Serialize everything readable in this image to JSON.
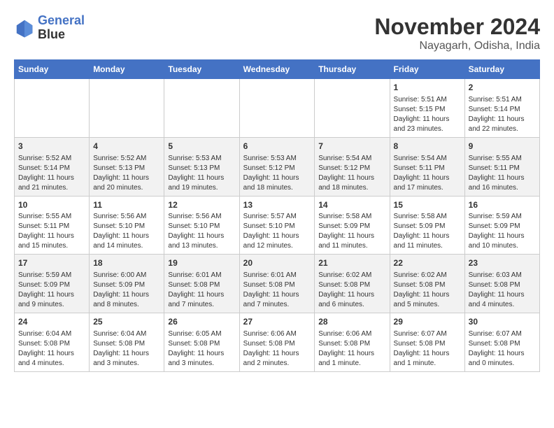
{
  "header": {
    "logo_line1": "General",
    "logo_line2": "Blue",
    "title": "November 2024",
    "subtitle": "Nayagarh, Odisha, India"
  },
  "days_of_week": [
    "Sunday",
    "Monday",
    "Tuesday",
    "Wednesday",
    "Thursday",
    "Friday",
    "Saturday"
  ],
  "weeks": [
    [
      {
        "day": "",
        "info": ""
      },
      {
        "day": "",
        "info": ""
      },
      {
        "day": "",
        "info": ""
      },
      {
        "day": "",
        "info": ""
      },
      {
        "day": "",
        "info": ""
      },
      {
        "day": "1",
        "info": "Sunrise: 5:51 AM\nSunset: 5:15 PM\nDaylight: 11 hours and 23 minutes."
      },
      {
        "day": "2",
        "info": "Sunrise: 5:51 AM\nSunset: 5:14 PM\nDaylight: 11 hours and 22 minutes."
      }
    ],
    [
      {
        "day": "3",
        "info": "Sunrise: 5:52 AM\nSunset: 5:14 PM\nDaylight: 11 hours and 21 minutes."
      },
      {
        "day": "4",
        "info": "Sunrise: 5:52 AM\nSunset: 5:13 PM\nDaylight: 11 hours and 20 minutes."
      },
      {
        "day": "5",
        "info": "Sunrise: 5:53 AM\nSunset: 5:13 PM\nDaylight: 11 hours and 19 minutes."
      },
      {
        "day": "6",
        "info": "Sunrise: 5:53 AM\nSunset: 5:12 PM\nDaylight: 11 hours and 18 minutes."
      },
      {
        "day": "7",
        "info": "Sunrise: 5:54 AM\nSunset: 5:12 PM\nDaylight: 11 hours and 18 minutes."
      },
      {
        "day": "8",
        "info": "Sunrise: 5:54 AM\nSunset: 5:11 PM\nDaylight: 11 hours and 17 minutes."
      },
      {
        "day": "9",
        "info": "Sunrise: 5:55 AM\nSunset: 5:11 PM\nDaylight: 11 hours and 16 minutes."
      }
    ],
    [
      {
        "day": "10",
        "info": "Sunrise: 5:55 AM\nSunset: 5:11 PM\nDaylight: 11 hours and 15 minutes."
      },
      {
        "day": "11",
        "info": "Sunrise: 5:56 AM\nSunset: 5:10 PM\nDaylight: 11 hours and 14 minutes."
      },
      {
        "day": "12",
        "info": "Sunrise: 5:56 AM\nSunset: 5:10 PM\nDaylight: 11 hours and 13 minutes."
      },
      {
        "day": "13",
        "info": "Sunrise: 5:57 AM\nSunset: 5:10 PM\nDaylight: 11 hours and 12 minutes."
      },
      {
        "day": "14",
        "info": "Sunrise: 5:58 AM\nSunset: 5:09 PM\nDaylight: 11 hours and 11 minutes."
      },
      {
        "day": "15",
        "info": "Sunrise: 5:58 AM\nSunset: 5:09 PM\nDaylight: 11 hours and 11 minutes."
      },
      {
        "day": "16",
        "info": "Sunrise: 5:59 AM\nSunset: 5:09 PM\nDaylight: 11 hours and 10 minutes."
      }
    ],
    [
      {
        "day": "17",
        "info": "Sunrise: 5:59 AM\nSunset: 5:09 PM\nDaylight: 11 hours and 9 minutes."
      },
      {
        "day": "18",
        "info": "Sunrise: 6:00 AM\nSunset: 5:09 PM\nDaylight: 11 hours and 8 minutes."
      },
      {
        "day": "19",
        "info": "Sunrise: 6:01 AM\nSunset: 5:08 PM\nDaylight: 11 hours and 7 minutes."
      },
      {
        "day": "20",
        "info": "Sunrise: 6:01 AM\nSunset: 5:08 PM\nDaylight: 11 hours and 7 minutes."
      },
      {
        "day": "21",
        "info": "Sunrise: 6:02 AM\nSunset: 5:08 PM\nDaylight: 11 hours and 6 minutes."
      },
      {
        "day": "22",
        "info": "Sunrise: 6:02 AM\nSunset: 5:08 PM\nDaylight: 11 hours and 5 minutes."
      },
      {
        "day": "23",
        "info": "Sunrise: 6:03 AM\nSunset: 5:08 PM\nDaylight: 11 hours and 4 minutes."
      }
    ],
    [
      {
        "day": "24",
        "info": "Sunrise: 6:04 AM\nSunset: 5:08 PM\nDaylight: 11 hours and 4 minutes."
      },
      {
        "day": "25",
        "info": "Sunrise: 6:04 AM\nSunset: 5:08 PM\nDaylight: 11 hours and 3 minutes."
      },
      {
        "day": "26",
        "info": "Sunrise: 6:05 AM\nSunset: 5:08 PM\nDaylight: 11 hours and 3 minutes."
      },
      {
        "day": "27",
        "info": "Sunrise: 6:06 AM\nSunset: 5:08 PM\nDaylight: 11 hours and 2 minutes."
      },
      {
        "day": "28",
        "info": "Sunrise: 6:06 AM\nSunset: 5:08 PM\nDaylight: 11 hours and 1 minute."
      },
      {
        "day": "29",
        "info": "Sunrise: 6:07 AM\nSunset: 5:08 PM\nDaylight: 11 hours and 1 minute."
      },
      {
        "day": "30",
        "info": "Sunrise: 6:07 AM\nSunset: 5:08 PM\nDaylight: 11 hours and 0 minutes."
      }
    ]
  ]
}
